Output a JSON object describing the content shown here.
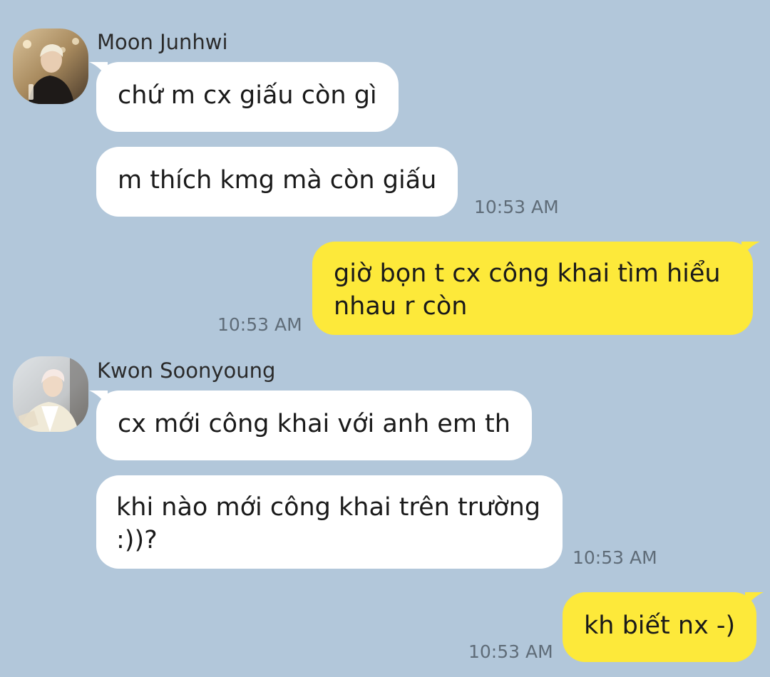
{
  "colors": {
    "background": "#b2c7da",
    "incoming_bubble": "#ffffff",
    "outgoing_bubble": "#fde93a",
    "timestamp": "#5f6c78"
  },
  "chat": {
    "group1": {
      "sender": "Moon Junhwi",
      "avatar_icon": "profile-photo",
      "messages": [
        "chứ m cx giấu còn gì",
        "m thích kmg mà còn giấu"
      ],
      "time": "10:53 AM"
    },
    "outgoing1": {
      "text": "giờ bọn t cx công khai tìm hiểu nhau r còn",
      "time": "10:53 AM"
    },
    "group2": {
      "sender": "Kwon Soonyoung",
      "avatar_icon": "profile-photo",
      "messages": [
        "cx mới công khai với anh em th",
        "khi nào mới công khai trên trường :))?"
      ],
      "time": "10:53 AM"
    },
    "outgoing2": {
      "text": "kh biết nx -)",
      "time": "10:53 AM"
    }
  }
}
